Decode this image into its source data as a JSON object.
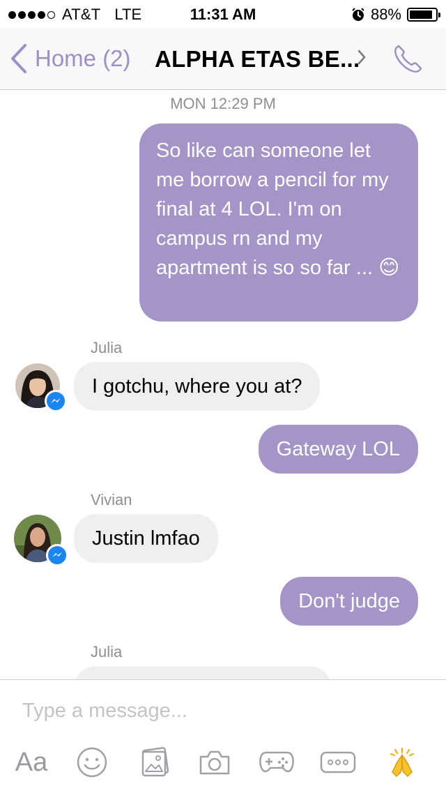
{
  "status_bar": {
    "carrier": "AT&T",
    "network": "LTE",
    "time": "11:31 AM",
    "battery_percent": "88%",
    "battery_level": 0.88,
    "signal_bars_filled": 4,
    "signal_bars_total": 5
  },
  "nav": {
    "back_label": "Home (2)",
    "title": "ALPHA ETAS BE...",
    "accent_color": "#9e8fc6"
  },
  "conversation": {
    "timestamp": "MON 12:29 PM",
    "messages": [
      {
        "direction": "out",
        "text": "So like can someone let me borrow a pencil for my final at 4 LOL. I'm on campus rn and my apartment is so so far ... 😊"
      },
      {
        "direction": "in",
        "sender": "Julia",
        "text": "I gotchu, where you at?"
      },
      {
        "direction": "out",
        "text": "Gateway LOL"
      },
      {
        "direction": "in",
        "sender": "Vivian",
        "text": "Justin lmfao"
      },
      {
        "direction": "out",
        "text": "Don't judge"
      },
      {
        "direction": "in",
        "sender": "Julia",
        "text": ""
      }
    ],
    "outgoing_bubble_color": "#a594c8",
    "incoming_bubble_color": "#efefef"
  },
  "composer": {
    "placeholder": "Type a message...",
    "text_button_label": "Aa",
    "toolbar_icons": [
      "text-format-icon",
      "emoji-icon",
      "photo-gallery-icon",
      "camera-icon",
      "game-controller-icon",
      "more-icon",
      "folded-hands-icon"
    ]
  }
}
